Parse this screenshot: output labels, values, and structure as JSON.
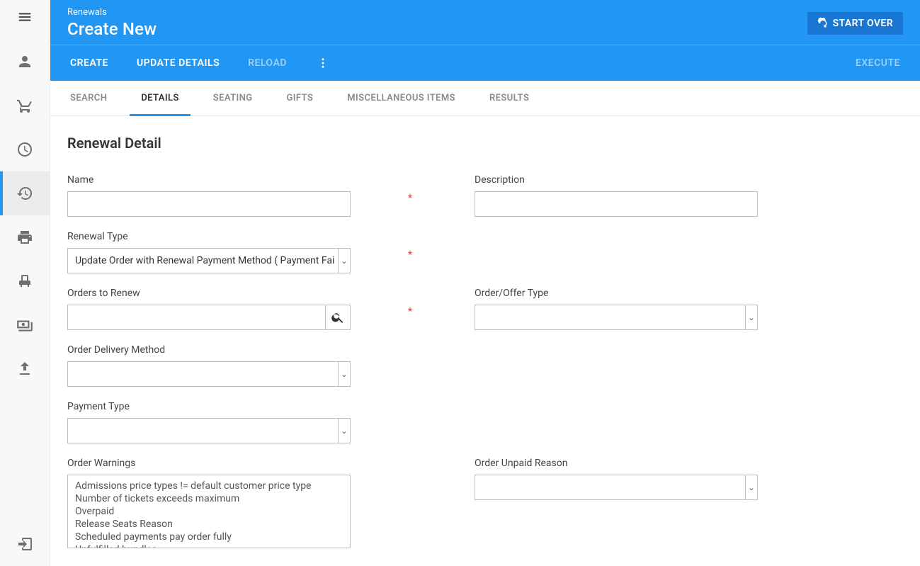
{
  "header": {
    "breadcrumb": "Renewals",
    "title": "Create New",
    "start_over": "START OVER",
    "actions": {
      "create": "CREATE",
      "update_details": "UPDATE DETAILS",
      "reload": "RELOAD",
      "execute": "EXECUTE"
    }
  },
  "subtabs": {
    "search": "SEARCH",
    "details": "DETAILS",
    "seating": "SEATING",
    "gifts": "GIFTS",
    "misc": "MISCELLANEOUS ITEMS",
    "results": "RESULTS",
    "active": "details"
  },
  "section": {
    "title": "Renewal Detail"
  },
  "form": {
    "name": {
      "label": "Name",
      "value": "",
      "required": true
    },
    "description": {
      "label": "Description",
      "value": ""
    },
    "renewal_type": {
      "label": "Renewal Type",
      "value": "Update Order with Renewal Payment Method ( Payment Fai",
      "required": true
    },
    "orders_to_renew": {
      "label": "Orders to Renew",
      "value": "",
      "required": true
    },
    "order_offer_type": {
      "label": "Order/Offer Type",
      "value": ""
    },
    "delivery_method": {
      "label": "Order Delivery Method",
      "value": ""
    },
    "payment_type": {
      "label": "Payment Type",
      "value": ""
    },
    "order_warnings": {
      "label": "Order Warnings",
      "options": [
        "Admissions price types != default customer price type",
        "Number of tickets exceeds maximum",
        "Overpaid",
        "Release Seats Reason",
        "Scheduled payments pay order fully",
        "Unfulfilled bundles"
      ]
    },
    "order_unpaid_reason": {
      "label": "Order Unpaid Reason",
      "value": ""
    }
  }
}
